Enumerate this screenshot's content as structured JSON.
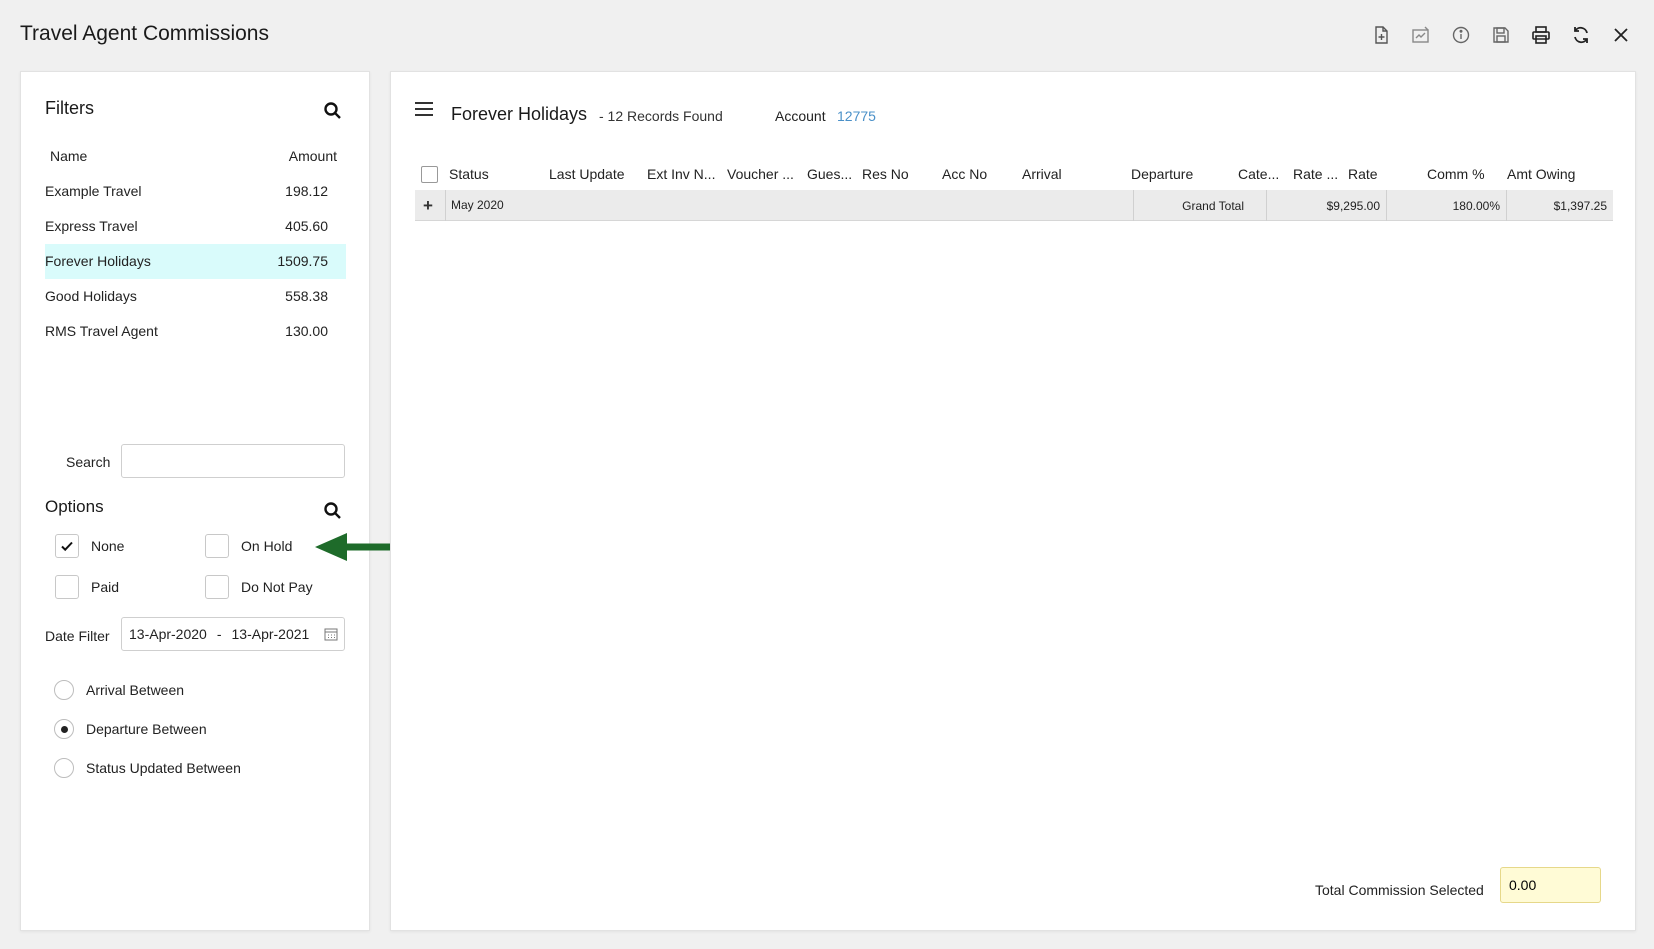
{
  "window": {
    "title": "Travel Agent Commissions"
  },
  "toolbar": {
    "icons": [
      "add-document-icon",
      "edit-document-icon",
      "info-icon",
      "save-icon",
      "print-icon",
      "refresh-icon",
      "close-icon"
    ]
  },
  "filters": {
    "heading": "Filters",
    "col_name": "Name",
    "col_amount": "Amount",
    "items": [
      {
        "name": "Example Travel",
        "amount": "198.12"
      },
      {
        "name": "Express Travel",
        "amount": "405.60"
      },
      {
        "name": "Forever Holidays",
        "amount": "1509.75",
        "selected": true
      },
      {
        "name": "Good Holidays",
        "amount": "558.38"
      },
      {
        "name": "RMS Travel Agent",
        "amount": "130.00"
      }
    ],
    "search_label": "Search",
    "search_value": ""
  },
  "options": {
    "heading": "Options",
    "none": {
      "label": "None",
      "checked": true
    },
    "on_hold": {
      "label": "On Hold",
      "checked": false
    },
    "paid": {
      "label": "Paid",
      "checked": false
    },
    "do_not_pay": {
      "label": "Do Not Pay",
      "checked": false
    }
  },
  "date_filter": {
    "label": "Date Filter",
    "from": "13-Apr-2020",
    "separator": "-",
    "to": "13-Apr-2021",
    "radios": [
      {
        "label": "Arrival Between",
        "selected": false
      },
      {
        "label": "Departure Between",
        "selected": true
      },
      {
        "label": "Status Updated Between",
        "selected": false
      }
    ]
  },
  "main": {
    "agent_name": "Forever Holidays",
    "records_found": "- 12 Records Found",
    "account_label": "Account",
    "account_value": "12775",
    "columns": [
      "Status",
      "Last Update",
      "Ext Inv N...",
      "Voucher ...",
      "Gues...",
      "Res No",
      "Acc No",
      "Arrival",
      "Departure",
      "Cate...",
      "Rate ...",
      "Rate",
      "Comm %",
      "Amt Owing"
    ],
    "group_row": {
      "expand": "+",
      "label": "May 2020",
      "grand_total_label": "Grand Total",
      "rate": "$9,295.00",
      "comm": "180.00%",
      "amt_owing": "$1,397.25"
    },
    "total_commission_label": "Total Commission Selected",
    "total_commission_value": "0.00"
  },
  "colors": {
    "selected_row": "#d9fbfb",
    "account_link": "#4a90c8",
    "arrow": "#1e6b2a",
    "total_field_bg": "#fffbd6"
  }
}
